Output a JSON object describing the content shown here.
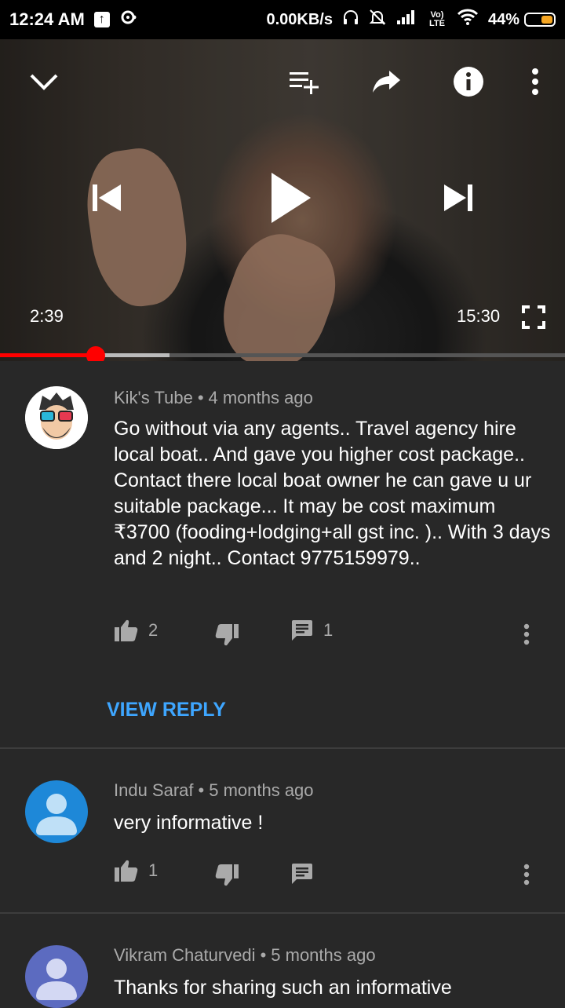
{
  "status_bar": {
    "time": "12:24 AM",
    "upload_badge": "↑",
    "speed": "0.00KB/s",
    "network_label": "Vo) LTE",
    "battery": "44%",
    "battery_level": 0.44,
    "battery_color": "#f5a623"
  },
  "player": {
    "current_time": "2:39",
    "total_time": "15:30",
    "progress": 0.17,
    "buffered": 0.3,
    "icons": [
      "minimize-chevron-icon",
      "add-to-queue-icon",
      "share-icon",
      "info-icon",
      "more-vert-icon",
      "skip-previous-icon",
      "play-icon",
      "skip-next-icon",
      "fullscreen-icon"
    ]
  },
  "comments": [
    {
      "author": "Kik's Tube",
      "separator": "•",
      "age": "4 months ago",
      "text": "Go without via any agents.. Travel agency hire local boat.. And gave you higher cost package.. Contact there local boat owner he can gave u ur suitable package... It may be cost  maximum ₹3700 (fooding+lodging+all gst inc. ).. With 3 days and 2 night.. Contact 9775159979..",
      "likes": "2",
      "replies": "1",
      "view_reply": "VIEW REPLY"
    },
    {
      "author": "Indu Saraf",
      "separator": "•",
      "age": "5 months ago",
      "text": "very informative !",
      "likes": "1",
      "replies": ""
    },
    {
      "author": "Vikram Chaturvedi",
      "separator": "•",
      "age": "5 months ago",
      "text": "Thanks for sharing such an informative"
    }
  ],
  "colors": {
    "accent": "#3ea6ff",
    "progress": "#ff0000",
    "background": "#282828"
  }
}
